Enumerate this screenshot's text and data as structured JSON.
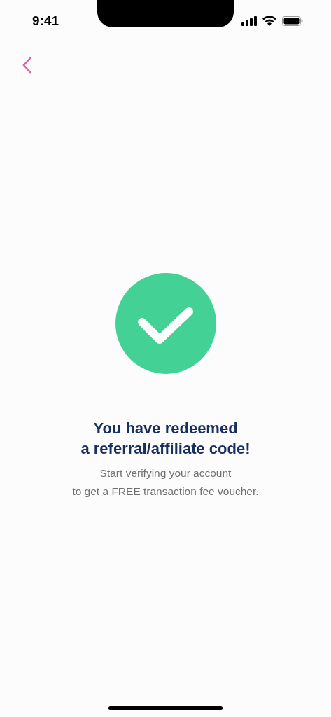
{
  "status_bar": {
    "time": "9:41"
  },
  "title": [
    "You have redeemed",
    "a referral/affiliate code!"
  ],
  "message": [
    "Start verifying your account",
    "to get a FREE transaction fee voucher."
  ]
}
